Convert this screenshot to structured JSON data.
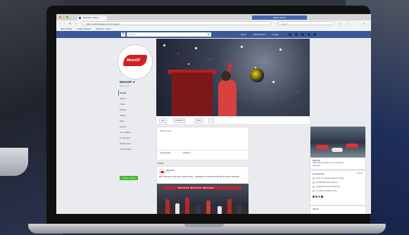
{
  "browser": {
    "tab_title": "MotoGP - Home",
    "url": "https://www.facebook.com/motogp/",
    "search_placeholder": "Search",
    "bookmarks": [
      "Most Visited",
      "Getting Started",
      "MotoGP - Home"
    ]
  },
  "facebook": {
    "logo": "f",
    "search_placeholder": "Search",
    "nav": [
      "Home",
      "Find Friends",
      "Create"
    ]
  },
  "page": {
    "name": "MotoGP ✔",
    "handle": "@MotoGP",
    "logo_text": "MotoGP",
    "nav_items": [
      "Home",
      "About",
      "Posts",
      "Photos",
      "Videos",
      "Shop",
      "Events",
      "Live Videos",
      "Community",
      "Mobile Apps",
      "Info and Ads"
    ],
    "create_button": "Create a Page"
  },
  "actions": {
    "like": "Like",
    "follow": "Following",
    "share": "Share",
    "more": "...",
    "signup": "Watch Videos"
  },
  "compose": {
    "placeholder": "Write a post...",
    "tag_friends": "Tag Friends",
    "check_in": "Check in"
  },
  "feed": {
    "section_label": "Posts",
    "post": {
      "author": "MotoGP",
      "time": "1 hr",
      "text": "Marc Marquez's final stint: special trophy... Dedication at Valencia 2018. Be the first to celebrate!",
      "image_banner": "MOTOGP MOTOGP MOTOGP"
    }
  },
  "right_column": {
    "promo_title": "MotoGP",
    "promo_text": "Follow all the action, live on Facebook",
    "promo_link": "See More",
    "community_title": "Community",
    "community_link": "See All",
    "community_rows": [
      "Invite your friends to like this Page",
      "16,300,000 people like this",
      "15,900,000 people follow this",
      "17 others checked in here"
    ],
    "about_title": "About"
  },
  "colors": {
    "fb_blue": "#3b5998",
    "brand_red": "#cf2020",
    "create_green": "#42b72a"
  }
}
